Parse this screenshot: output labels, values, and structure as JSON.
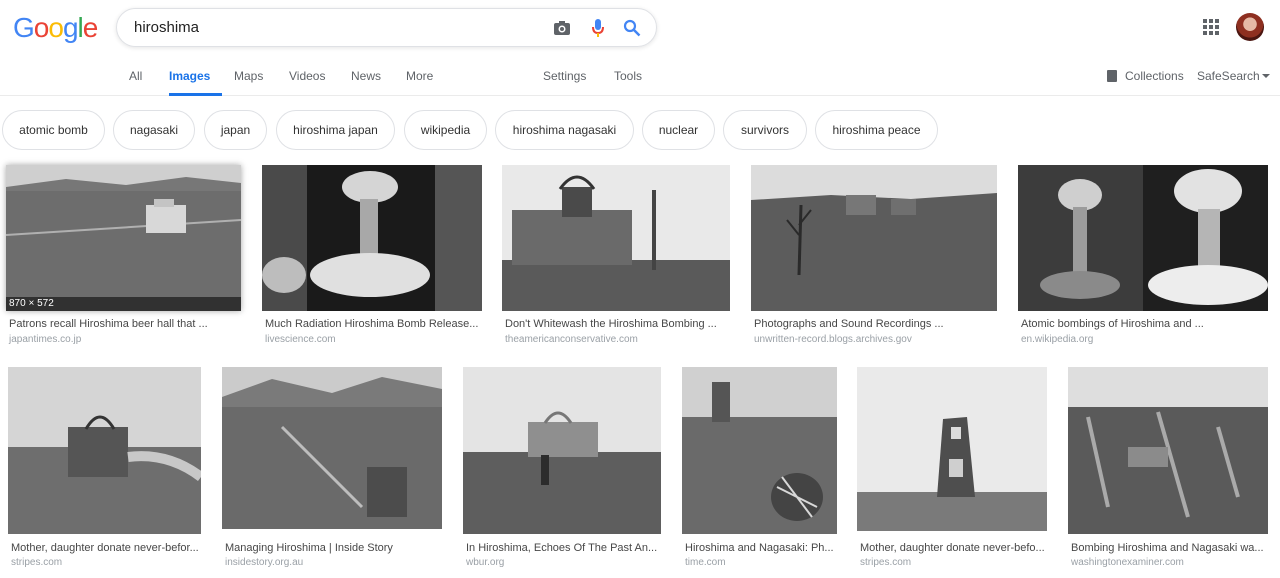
{
  "logo": "Google",
  "search": {
    "query": "hiroshima"
  },
  "nav": {
    "tabs": [
      "All",
      "Images",
      "Maps",
      "Videos",
      "News",
      "More"
    ],
    "active_tab": "Images",
    "settings": "Settings",
    "tools": "Tools",
    "collections": "Collections",
    "safesearch": "SafeSearch"
  },
  "chips": [
    "atomic bomb",
    "nagasaki",
    "japan",
    "hiroshima japan",
    "wikipedia",
    "hiroshima nagasaki",
    "nuclear",
    "survivors",
    "hiroshima peace"
  ],
  "results": [
    {
      "title": "Patrons recall Hiroshima beer hall that ...",
      "source": "japantimes.co.jp",
      "dims": "870 × 572"
    },
    {
      "title": "Much Radiation Hiroshima Bomb Release...",
      "source": "livescience.com"
    },
    {
      "title": "Don't Whitewash the Hiroshima Bombing ...",
      "source": "theamericanconservative.com"
    },
    {
      "title": "Photographs and Sound Recordings ...",
      "source": "unwritten-record.blogs.archives.gov"
    },
    {
      "title": "Atomic bombings of Hiroshima and ...",
      "source": "en.wikipedia.org"
    },
    {
      "title": "Mother, daughter donate never-befor...",
      "source": "stripes.com"
    },
    {
      "title": "Managing Hiroshima | Inside Story",
      "source": "insidestory.org.au"
    },
    {
      "title": "In Hiroshima, Echoes Of The Past An...",
      "source": "wbur.org"
    },
    {
      "title": "Hiroshima and Nagasaki: Ph...",
      "source": "time.com"
    },
    {
      "title": "Mother, daughter donate never-befo...",
      "source": "stripes.com"
    },
    {
      "title": "Bombing Hiroshima and Nagasaki wa...",
      "source": "washingtonexaminer.com"
    }
  ],
  "colors": {
    "accent": "#1a73e8",
    "logo": [
      "#4285f4",
      "#ea4335",
      "#fbbc05",
      "#4285f4",
      "#34a853",
      "#ea4335"
    ]
  }
}
